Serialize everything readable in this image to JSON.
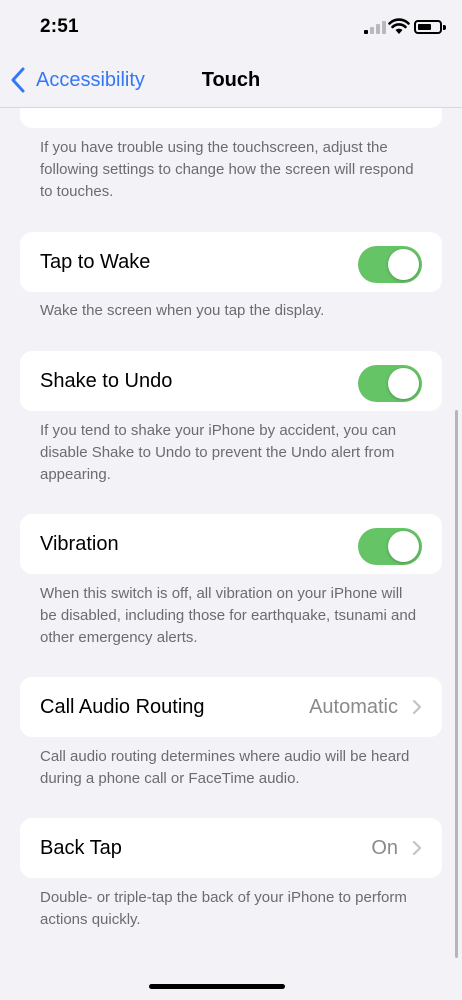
{
  "status_bar": {
    "time": "2:51"
  },
  "nav": {
    "back_label": "Accessibility",
    "title": "Touch"
  },
  "intro_footer": "If you have trouble using the touchscreen, adjust the following settings to change how the screen will respond to touches.",
  "tap_to_wake": {
    "label": "Tap to Wake",
    "on": true,
    "footer": "Wake the screen when you tap the display."
  },
  "shake_to_undo": {
    "label": "Shake to Undo",
    "on": true,
    "footer": "If you tend to shake your iPhone by accident, you can disable Shake to Undo to prevent the Undo alert from appearing."
  },
  "vibration": {
    "label": "Vibration",
    "on": true,
    "footer": "When this switch is off, all vibration on your iPhone will be disabled, including those for earthquake, tsunami and other emergency alerts."
  },
  "call_audio_routing": {
    "label": "Call Audio Routing",
    "value": "Automatic",
    "footer": "Call audio routing determines where audio will be heard during a phone call or FaceTime audio."
  },
  "back_tap": {
    "label": "Back Tap",
    "value": "On",
    "footer": "Double- or triple-tap the back of your iPhone to perform actions quickly."
  },
  "colors": {
    "accent": "#3478f6",
    "toggle_on": "#65c466",
    "background": "#f2f2f7",
    "secondary_text": "#6c6c70"
  },
  "icons": [
    "cellular-signal-icon",
    "wifi-icon",
    "battery-icon",
    "chevron-left-icon",
    "chevron-right-icon"
  ]
}
